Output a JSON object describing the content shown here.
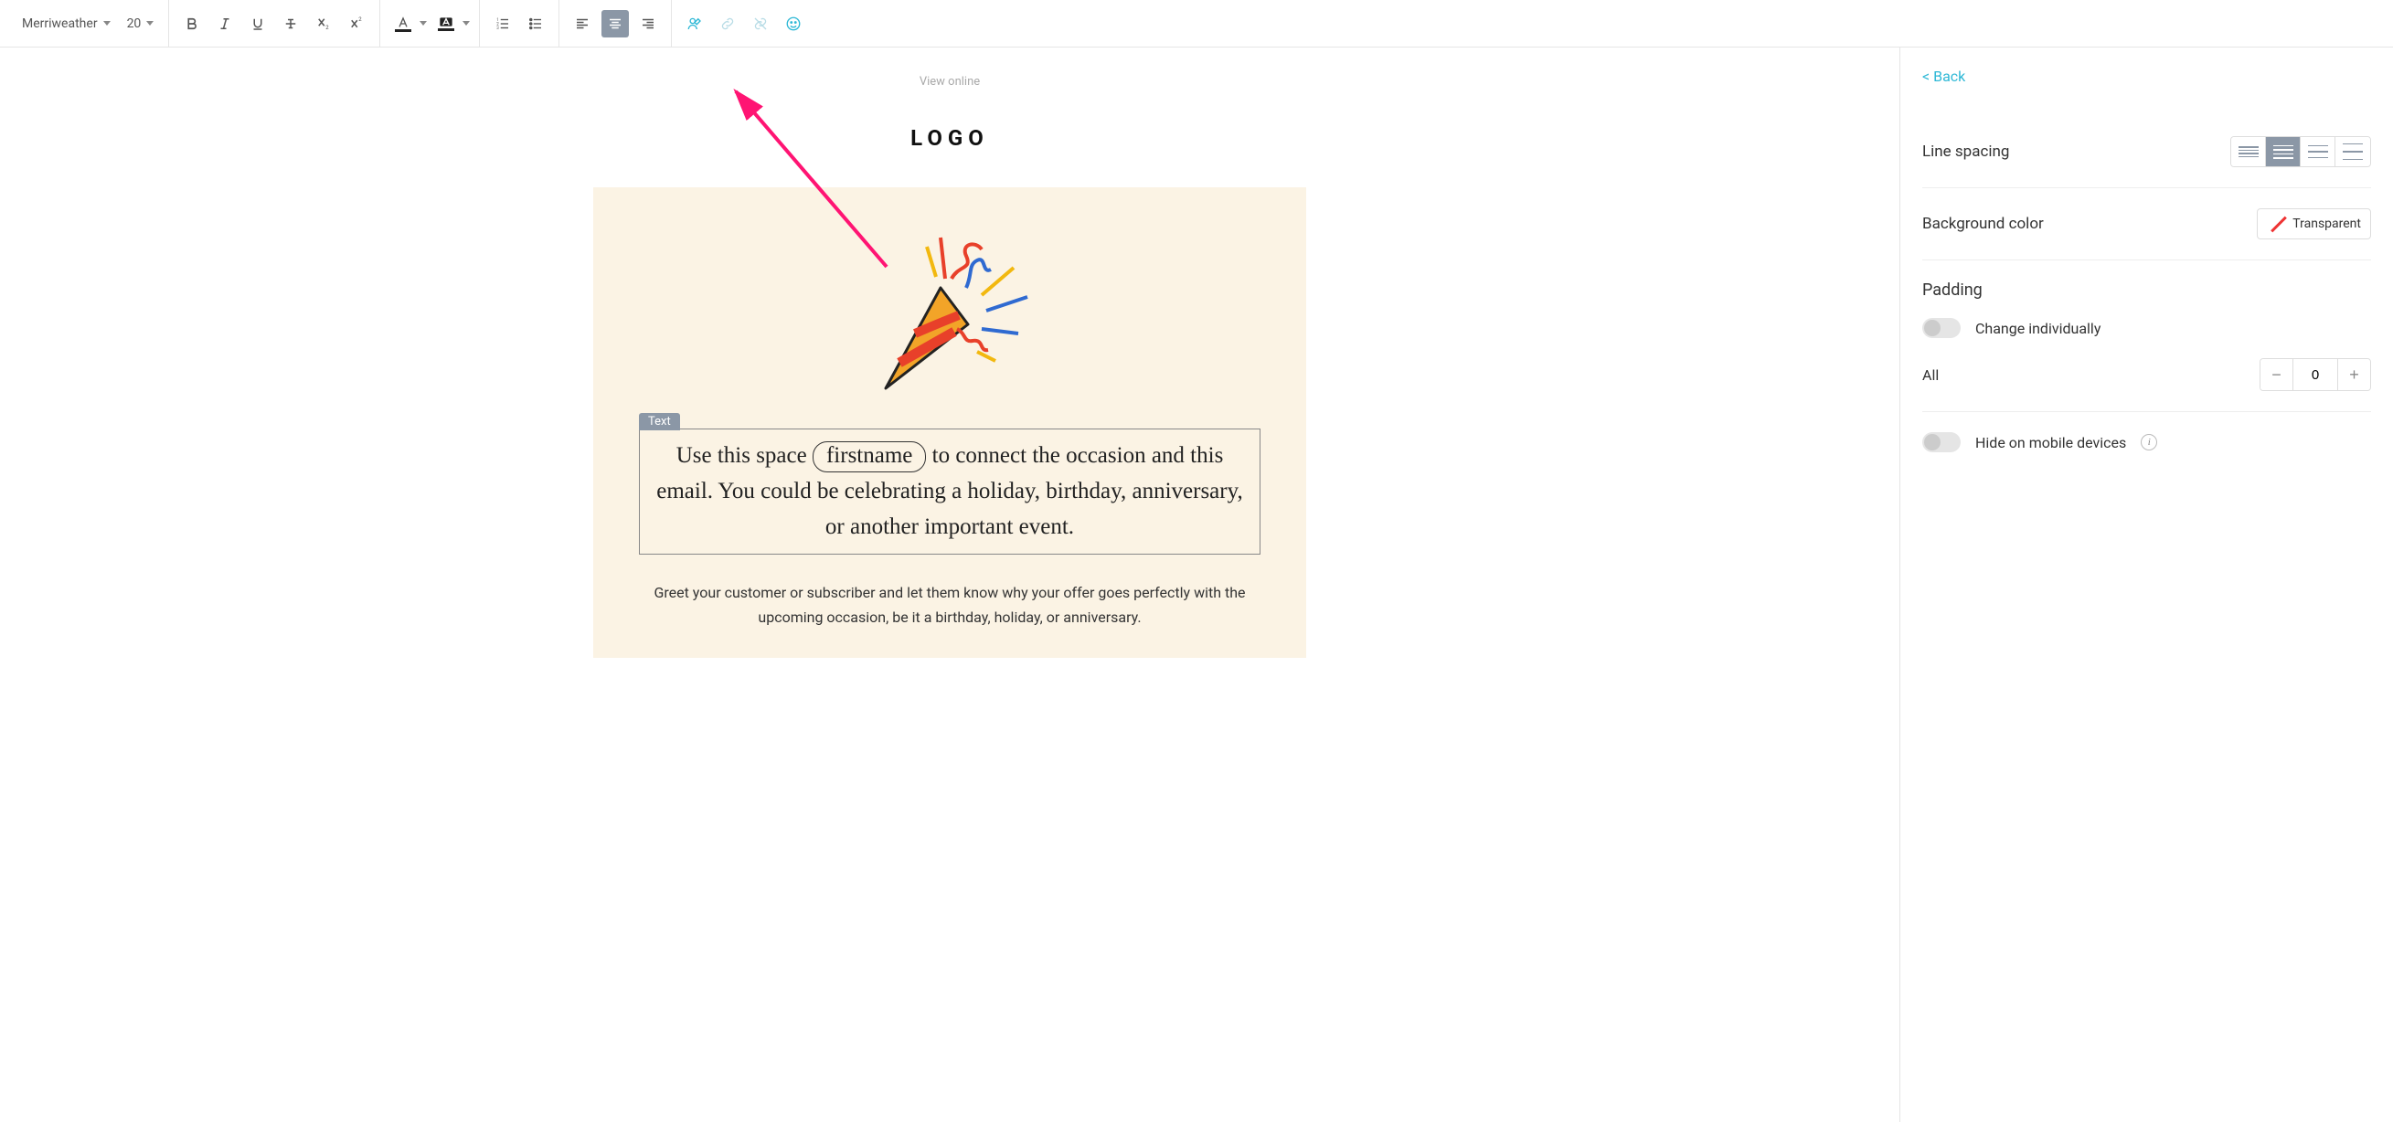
{
  "toolbar": {
    "font_family": "Merriweather",
    "font_size": "20"
  },
  "canvas": {
    "view_online": "View online",
    "logo": "LOGO",
    "text_block_label": "Text",
    "main_text_before": "Use this space",
    "main_text_placeholder": "firstname",
    "main_text_after": "to connect the occasion and this email. You could be celebrating a holiday, birthday, anniversary, or another important event.",
    "body_text": "Greet your customer or subscriber and let them know why your offer goes perfectly with the upcoming occasion, be it a birthday, holiday, or anniversary."
  },
  "sidebar": {
    "back": "< Back",
    "line_spacing_label": "Line spacing",
    "bg_color_label": "Background color",
    "bg_value": "Transparent",
    "padding_label": "Padding",
    "change_individually": "Change individually",
    "all_label": "All",
    "padding_value": "0",
    "hide_mobile": "Hide on mobile devices"
  }
}
